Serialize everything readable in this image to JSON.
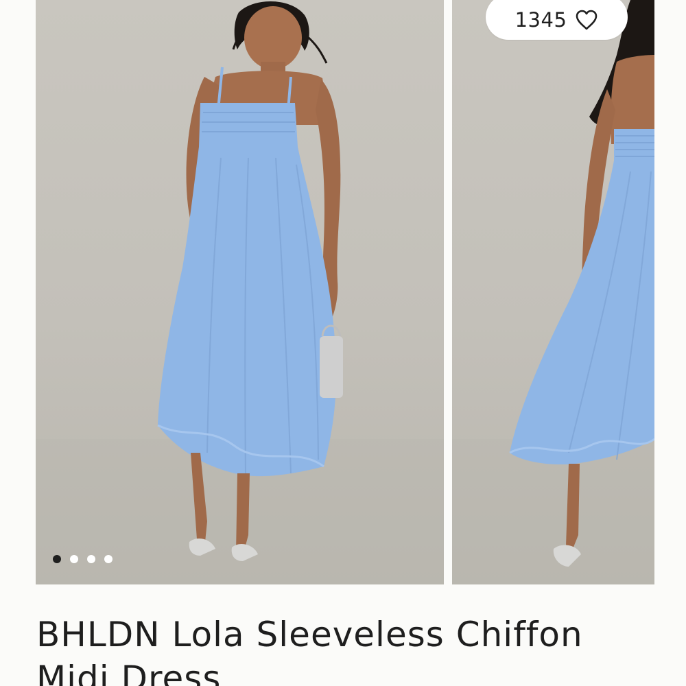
{
  "product": {
    "title": "BHLDN Lola Sleeveless Chiffon Midi Dress",
    "like_count": "1345",
    "images": [
      {
        "alt": "Model wearing the light blue chiffon midi dress, front view"
      },
      {
        "alt": "Model wearing the light blue chiffon midi dress, back view"
      }
    ],
    "carousel": {
      "total": 4,
      "active_index": 0
    }
  },
  "colors": {
    "dress": "#8fb6e6",
    "background": "#c6c3bc",
    "page": "#fbfbf9",
    "text": "#1e1e1e"
  },
  "icons": {
    "like": "heart-outline-icon"
  }
}
